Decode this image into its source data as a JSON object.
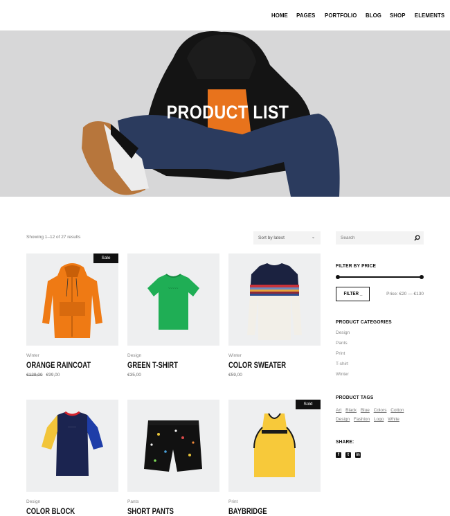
{
  "nav": {
    "items": [
      "HOME",
      "PAGES",
      "PORTFOLIO",
      "BLOG",
      "SHOP",
      "ELEMENTS"
    ]
  },
  "hero": {
    "title": "PRODUCT LIST"
  },
  "shop": {
    "result_count": "Showing 1–12 of 27 results",
    "sort_selected": "Sort by latest"
  },
  "products": [
    {
      "category": "Winter",
      "title": "ORANGE RAINCOAT",
      "old_price": "€129,00",
      "price": "€99,00",
      "badge": "Sale"
    },
    {
      "category": "Design",
      "title": "GREEN T-SHIRT",
      "old_price": "",
      "price": "€35,00",
      "badge": ""
    },
    {
      "category": "Winter",
      "title": "COLOR SWEATER",
      "old_price": "",
      "price": "€59,00",
      "badge": ""
    },
    {
      "category": "Design",
      "title": "COLOR BLOCK",
      "old_price": "",
      "price": "",
      "badge": ""
    },
    {
      "category": "Pants",
      "title": "SHORT PANTS",
      "old_price": "",
      "price": "",
      "badge": ""
    },
    {
      "category": "Print",
      "title": "BAYBRIDGE",
      "old_price": "",
      "price": "",
      "badge": "Sold"
    }
  ],
  "sidebar": {
    "search_placeholder": "Search",
    "filter_heading": "FILTER BY PRICE",
    "price_min_fraction": 0.0,
    "price_max_fraction": 1.0,
    "filter_button": "FILTER _",
    "price_range": "Price: €20 — €130",
    "categories_heading": "PRODUCT CATEGORIES",
    "categories": [
      "Design",
      "Pants",
      "Print",
      "T-shirt",
      "Winter"
    ],
    "tags_heading": "PRODUCT TAGS",
    "tags": [
      "Art",
      "Black",
      "Blue",
      "Colors",
      "Cotton",
      "Design",
      "Fashion",
      "Logo",
      "White"
    ],
    "share_heading": "SHARE:",
    "share_icons": [
      "facebook-icon",
      "twitter-icon",
      "linkedin-icon"
    ]
  },
  "colors": {
    "accent": "#111111",
    "hero_bg": "#d7d7d8",
    "card_bg": "#eeeff0"
  }
}
